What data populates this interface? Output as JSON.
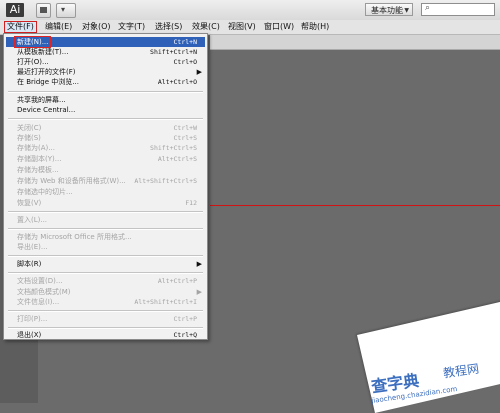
{
  "app": {
    "logo": "Ai",
    "tb_button2": "▾"
  },
  "workspace": {
    "label": "基本功能",
    "arrow": "▼"
  },
  "search": {
    "icon": "⌕"
  },
  "menubar": [
    {
      "label": "文件(F)"
    },
    {
      "label": "编辑(E)"
    },
    {
      "label": "对象(O)"
    },
    {
      "label": "文字(T)"
    },
    {
      "label": "选择(S)"
    },
    {
      "label": "效果(C)"
    },
    {
      "label": "视图(V)"
    },
    {
      "label": "窗口(W)"
    },
    {
      "label": "帮助(H)"
    }
  ],
  "file_menu": {
    "items": [
      {
        "label": "新建(N)...",
        "shortcut": "Ctrl+N"
      },
      {
        "label": "从模板新建(T)...",
        "shortcut": "Shift+Ctrl+N"
      },
      {
        "label": "打开(O)...",
        "shortcut": "Ctrl+O"
      },
      {
        "label": "最近打开的文件(F)",
        "submenu": "▶"
      },
      {
        "label": "在 Bridge 中浏览...",
        "shortcut": "Alt+Ctrl+O"
      },
      {
        "label": "共享我的屏幕..."
      },
      {
        "label": "Device Central..."
      },
      {
        "label": "关闭(C)",
        "shortcut": "Ctrl+W"
      },
      {
        "label": "存储(S)",
        "shortcut": "Ctrl+S"
      },
      {
        "label": "存储为(A)...",
        "shortcut": "Shift+Ctrl+S"
      },
      {
        "label": "存储副本(Y)...",
        "shortcut": "Alt+Ctrl+S"
      },
      {
        "label": "存储为模板..."
      },
      {
        "label": "存储为 Web 和设备所用格式(W)...",
        "shortcut": "Alt+Shift+Ctrl+S"
      },
      {
        "label": "存储选中的切片..."
      },
      {
        "label": "恢复(V)",
        "shortcut": "F12"
      },
      {
        "label": "置入(L)..."
      },
      {
        "label": "存储为 Microsoft Office 所用格式..."
      },
      {
        "label": "导出(E)..."
      },
      {
        "label": "脚本(R)",
        "submenu": "▶"
      },
      {
        "label": "文档设置(D)...",
        "shortcut": "Alt+Ctrl+P"
      },
      {
        "label": "文档颜色模式(M)",
        "submenu": "▶"
      },
      {
        "label": "文件信息(I)...",
        "shortcut": "Alt+Shift+Ctrl+I"
      },
      {
        "label": "打印(P)...",
        "shortcut": "Ctrl+P"
      },
      {
        "label": "退出(X)",
        "shortcut": "Ctrl+Q"
      }
    ]
  },
  "watermark": {
    "line1": "查字典",
    "line2": "教程网",
    "line3": "jiaocheng.chazidian.com"
  }
}
